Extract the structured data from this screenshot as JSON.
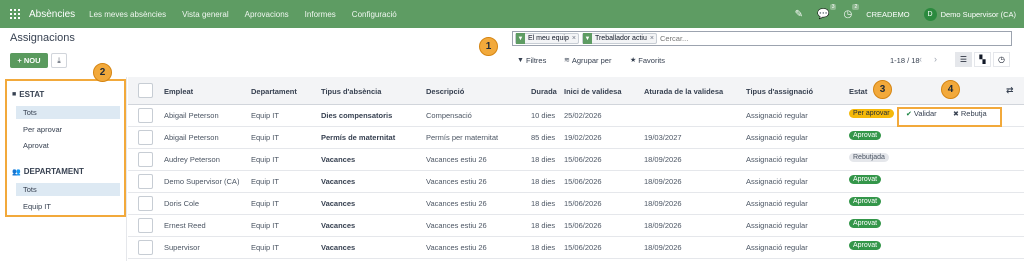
{
  "navbar": {
    "app_name": "Absències",
    "menu": [
      "Les meves absències",
      "Vista general",
      "Aprovacions",
      "Informes",
      "Configuració"
    ],
    "chat_count": "3",
    "activity_count": "2",
    "company": "CREADEMO",
    "avatar_initial": "D",
    "user": "Demo Supervisor (CA)",
    "accent_color": "#5e9c63"
  },
  "control": {
    "title": "Assignacions",
    "new_label": "NOU",
    "search": {
      "facets": [
        "El meu equip",
        "Treballador actiu"
      ],
      "placeholder": "Cercar..."
    },
    "filters_label": "Filtres",
    "group_by_label": "Agrupar per",
    "favorites_label": "Favorits",
    "pager": "1-18 / 18"
  },
  "sidebar": {
    "sections": [
      {
        "title": "ESTAT",
        "icon": "folder-icon",
        "items": [
          "Tots",
          "Per aprovar",
          "Aprovat"
        ],
        "active": 0
      },
      {
        "title": "DEPARTAMENT",
        "icon": "users-icon",
        "items": [
          "Tots",
          "Equip IT"
        ],
        "active": 0
      }
    ]
  },
  "table": {
    "headers": [
      "Empleat",
      "Departament",
      "Tipus d'absència",
      "Descripció",
      "Durada",
      "Inici de validesa",
      "Aturada de la validesa",
      "Tipus d'assignació",
      "Estat"
    ],
    "rows": [
      {
        "employee": "Abigail Peterson",
        "dept": "Equip IT",
        "type": "Dies compensatoris",
        "desc": "Compensació",
        "duration": "10 dies",
        "start": "25/02/2026",
        "end": "",
        "alloc": "Assignació regular",
        "status": "Per aprovar",
        "status_kind": "warn"
      },
      {
        "employee": "Abigail Peterson",
        "dept": "Equip IT",
        "type": "Permís de maternitat",
        "desc": "Permís per maternitat",
        "duration": "85 dies",
        "start": "19/02/2026",
        "end": "19/03/2027",
        "alloc": "Assignació regular",
        "status": "Aprovat",
        "status_kind": "ok"
      },
      {
        "employee": "Audrey Peterson",
        "dept": "Equip IT",
        "type": "Vacances",
        "desc": "Vacances estiu 26",
        "duration": "18 dies",
        "start": "15/06/2026",
        "end": "18/09/2026",
        "alloc": "Assignació regular",
        "status": "Rebutjada",
        "status_kind": "grey"
      },
      {
        "employee": "Demo Supervisor (CA)",
        "dept": "Equip IT",
        "type": "Vacances",
        "desc": "Vacances estiu 26",
        "duration": "18 dies",
        "start": "15/06/2026",
        "end": "18/09/2026",
        "alloc": "Assignació regular",
        "status": "Aprovat",
        "status_kind": "ok"
      },
      {
        "employee": "Doris Cole",
        "dept": "Equip IT",
        "type": "Vacances",
        "desc": "Vacances estiu 26",
        "duration": "18 dies",
        "start": "15/06/2026",
        "end": "18/09/2026",
        "alloc": "Assignació regular",
        "status": "Aprovat",
        "status_kind": "ok"
      },
      {
        "employee": "Ernest Reed",
        "dept": "Equip IT",
        "type": "Vacances",
        "desc": "Vacances estiu 26",
        "duration": "18 dies",
        "start": "15/06/2026",
        "end": "18/09/2026",
        "alloc": "Assignació regular",
        "status": "Aprovat",
        "status_kind": "ok"
      },
      {
        "employee": "Supervisor",
        "dept": "Equip IT",
        "type": "Vacances",
        "desc": "Vacances estiu 26",
        "duration": "18 dies",
        "start": "15/06/2026",
        "end": "18/09/2026",
        "alloc": "Assignació regular",
        "status": "Aprovat",
        "status_kind": "ok"
      }
    ],
    "validate_label": "Validar",
    "refuse_label": "Rebutja"
  },
  "callouts": [
    "1",
    "2",
    "3",
    "4"
  ]
}
